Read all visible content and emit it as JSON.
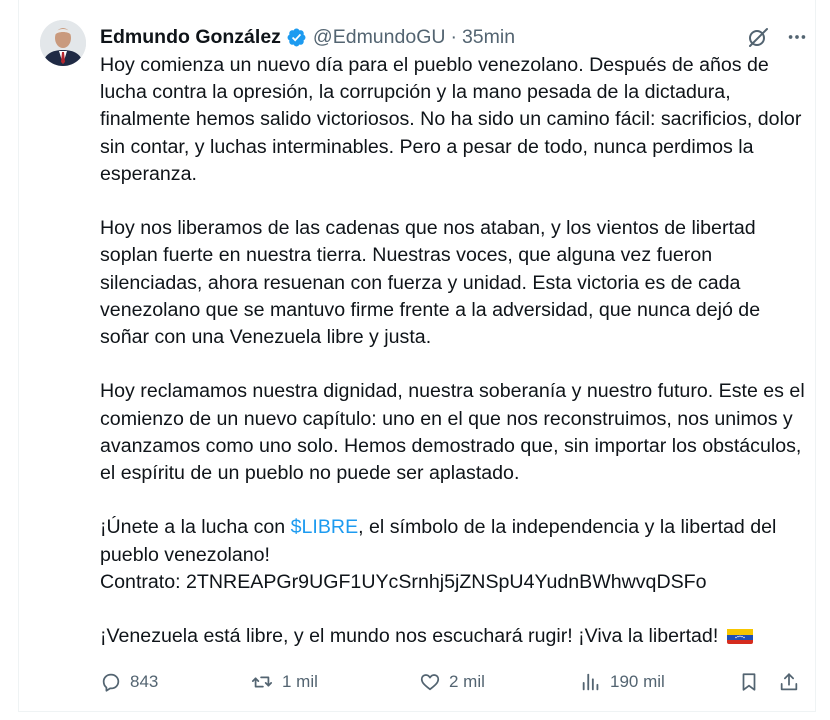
{
  "tweet": {
    "author": {
      "name": "Edmundo González",
      "handle": "@EdmundoGU",
      "separator": "·",
      "time": "35min"
    },
    "paragraphs": [
      {
        "text": "Hoy comienza un nuevo día para el pueblo venezolano. Después de años de lucha contra la opresión, la corrupción y la mano pesada de la dictadura, finalmente hemos salido victoriosos. No ha sido un camino fácil: sacrificios, dolor sin contar, y luchas interminables. Pero a pesar de todo, nunca perdimos la esperanza."
      },
      {
        "text": "Hoy nos liberamos de las cadenas que nos ataban, y los vientos de libertad soplan fuerte en nuestra tierra. Nuestras voces, que alguna vez fueron silenciadas, ahora resuenan con fuerza y unidad. Esta victoria es de cada venezolano que se mantuvo firme frente a la adversidad, que nunca dejó de soñar con una Venezuela libre y justa."
      },
      {
        "text": "Hoy reclamamos nuestra dignidad, nuestra soberanía y nuestro futuro. Este es el comienzo de un nuevo capítulo: uno en el que nos reconstruimos, nos unimos y avanzamos como uno solo. Hemos demostrado que, sin importar los obstáculos, el espíritu de un pueblo no puede ser aplastado."
      }
    ],
    "cta": {
      "before": "¡Únete a la lucha con ",
      "cashtag": "$LIBRE",
      "after": ", el símbolo de la independencia y la libertad del pueblo venezolano!",
      "contract_line": "Contrato: 2TNREAPGr9UGF1UYcSrnhj5jZNSpU4YudnBWhwvqDSFo"
    },
    "closing": "¡Venezuela está libre, y el mundo nos escuchará rugir! ¡Viva la libertad!",
    "flag_icon": "venezuela-flag-icon",
    "metrics": {
      "replies": "843",
      "reposts": "1 mil",
      "likes": "2 mil",
      "views": "190 mil"
    }
  },
  "colors": {
    "text": "#0f1419",
    "muted": "#536471",
    "link": "#1d9bf0",
    "verified": "#1d9bf0"
  },
  "icons": [
    "verified-badge-icon",
    "grok-icon",
    "more-icon",
    "reply-icon",
    "repost-icon",
    "like-icon",
    "views-icon",
    "bookmark-icon",
    "share-icon"
  ]
}
